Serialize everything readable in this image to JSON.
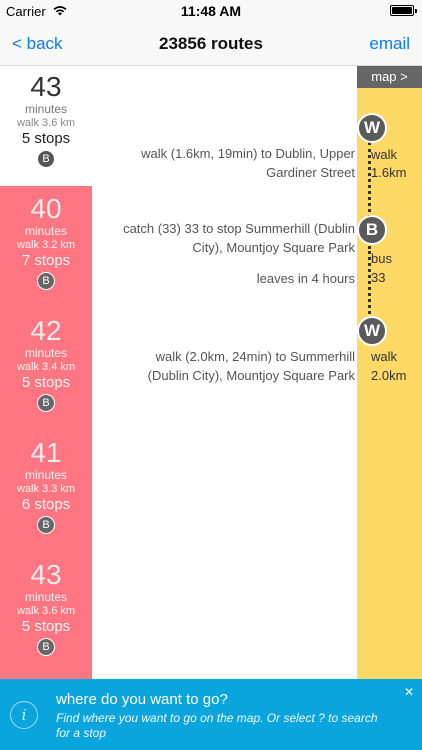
{
  "status": {
    "carrier": "Carrier",
    "time": "11:48 AM"
  },
  "nav": {
    "back": "< back",
    "title": "23856 routes",
    "email": "email"
  },
  "routes": [
    {
      "minutes": "43",
      "label": "minutes",
      "walk": "walk 3.6 km",
      "stops": "5 stops",
      "badge": "B"
    },
    {
      "minutes": "40",
      "label": "minutes",
      "walk": "walk 3.2 km",
      "stops": "7 stops",
      "badge": "B"
    },
    {
      "minutes": "42",
      "label": "minutes",
      "walk": "walk 3.4 km",
      "stops": "5 stops",
      "badge": "B"
    },
    {
      "minutes": "41",
      "label": "minutes",
      "walk": "walk 3.3 km",
      "stops": "6 stops",
      "badge": "B"
    },
    {
      "minutes": "43",
      "label": "minutes",
      "walk": "walk 3.6 km",
      "stops": "5 stops",
      "badge": "B"
    }
  ],
  "map_button": "map >",
  "steps": {
    "walk1": {
      "line1": "walk (1.6km, 19min) to Dublin, Upper",
      "line2": "Gardiner Street"
    },
    "catch": {
      "line1": "catch (33) 33  to stop Summerhill (Dublin",
      "line2": "City), Mountjoy Square Park"
    },
    "leaves": "leaves in  4 hours",
    "walk2": {
      "line1": "walk (2.0km, 24min) to Summerhill",
      "line2": "(Dublin City), Mountjoy Square Park"
    }
  },
  "timeline": {
    "w1": {
      "letter": "W",
      "mode": "walk",
      "detail": "1.6km"
    },
    "b": {
      "letter": "B",
      "mode": "bus",
      "detail": "33"
    },
    "w2": {
      "letter": "W",
      "mode": "walk",
      "detail": "2.0km"
    }
  },
  "banner": {
    "icon": "i",
    "title": "where do you want to go?",
    "subtitle": "Find where you want to go on the map. Or select ? to search for a stop",
    "close": "✕"
  },
  "colors": {
    "accent": "#0a7bff",
    "routes_bg": "#ff7582",
    "timeline_bg": "#ffd966",
    "banner_bg": "#0aa5dd"
  }
}
